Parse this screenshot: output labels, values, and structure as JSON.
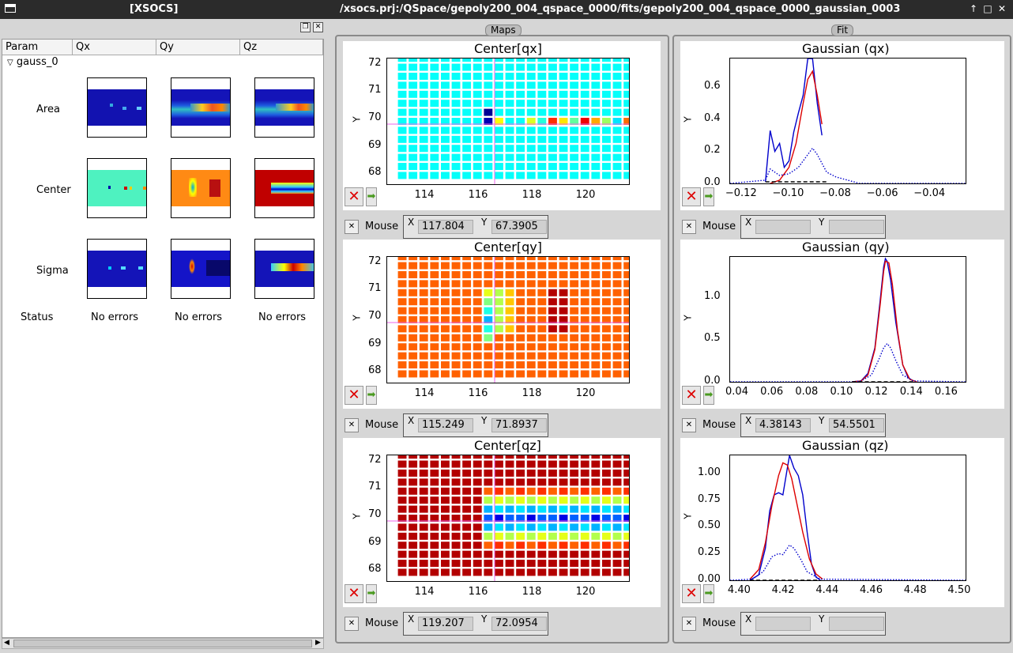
{
  "window": {
    "app_title": "[XSOCS]",
    "title": "/xsocs.prj:/QSpace/gepoly200_004_qspace_0000/fits/gepoly200_004_qspace_0000_gaussian_0003"
  },
  "left": {
    "columns": [
      "Param",
      "Qx",
      "Qy",
      "Qz"
    ],
    "tree_item": "gauss_0",
    "rows": [
      "Area",
      "Center",
      "Sigma"
    ],
    "status_label": "Status",
    "status_values": [
      "No errors",
      "No errors",
      "No errors"
    ]
  },
  "maps": {
    "group_title": "Maps",
    "plots": [
      {
        "title": "Center[qx]",
        "mouse_label": "Mouse",
        "x_label": "X",
        "y_label": "Y",
        "mouse_x": "117.804",
        "mouse_y": "67.3905"
      },
      {
        "title": "Center[qy]",
        "mouse_label": "Mouse",
        "x_label": "X",
        "y_label": "Y",
        "mouse_x": "115.249",
        "mouse_y": "71.8937"
      },
      {
        "title": "Center[qz]",
        "mouse_label": "Mouse",
        "x_label": "X",
        "y_label": "Y",
        "mouse_x": "119.207",
        "mouse_y": "72.0954"
      }
    ],
    "x_ticks": [
      "114",
      "116",
      "118",
      "120"
    ],
    "y_ticks": [
      "72",
      "71",
      "70",
      "69",
      "68"
    ]
  },
  "fit": {
    "group_title": "Fit",
    "plots": [
      {
        "title": "Gaussian (qx)",
        "mouse_label": "Mouse",
        "x_label": "X",
        "y_label": "Y",
        "mouse_x": "",
        "mouse_y": "",
        "x_ticks": [
          "−0.12",
          "−0.10",
          "−0.08",
          "−0.06",
          "−0.04"
        ],
        "y_ticks": [
          "0.6",
          "0.4",
          "0.2",
          "0.0"
        ]
      },
      {
        "title": "Gaussian (qy)",
        "mouse_label": "Mouse",
        "x_label": "X",
        "y_label": "Y",
        "mouse_x": "4.38143",
        "mouse_y": "54.5501",
        "x_ticks": [
          "0.04",
          "0.06",
          "0.08",
          "0.10",
          "0.12",
          "0.14",
          "0.16"
        ],
        "y_ticks": [
          "1.0",
          "0.5",
          "0.0"
        ]
      },
      {
        "title": "Gaussian (qz)",
        "mouse_label": "Mouse",
        "x_label": "X",
        "y_label": "Y",
        "mouse_x": "",
        "mouse_y": "",
        "x_ticks": [
          "4.40",
          "4.42",
          "4.44",
          "4.46",
          "4.48",
          "4.50"
        ],
        "y_ticks": [
          "1.00",
          "0.75",
          "0.50",
          "0.25",
          "0.00"
        ]
      }
    ]
  },
  "chart_data": [
    {
      "type": "heatmap",
      "title": "Center[qx]",
      "ylabel": "Y",
      "xlim": [
        112.6,
        121.6
      ],
      "ylim": [
        67.6,
        72.2
      ],
      "colormap": "jet",
      "crosshair": [
        116.6,
        69.8
      ]
    },
    {
      "type": "heatmap",
      "title": "Center[qy]",
      "ylabel": "Y",
      "xlim": [
        112.6,
        121.6
      ],
      "ylim": [
        67.6,
        72.2
      ],
      "colormap": "jet",
      "crosshair": [
        116.6,
        69.8
      ]
    },
    {
      "type": "heatmap",
      "title": "Center[qz]",
      "ylabel": "Y",
      "xlim": [
        112.6,
        121.6
      ],
      "ylim": [
        67.6,
        72.2
      ],
      "colormap": "jet",
      "crosshair": [
        116.6,
        69.8
      ]
    },
    {
      "type": "line",
      "title": "Gaussian (qx)",
      "ylabel": "Y",
      "xlim": [
        -0.125,
        -0.025
      ],
      "ylim": [
        0,
        0.78
      ],
      "series": [
        {
          "color": "#0000cc",
          "style": "solid",
          "x": [
            -0.11,
            -0.108,
            -0.106,
            -0.104,
            -0.102,
            -0.1,
            -0.098,
            -0.096,
            -0.094,
            -0.092,
            -0.09,
            -0.088,
            -0.086
          ],
          "y": [
            0.01,
            0.33,
            0.2,
            0.25,
            0.1,
            0.14,
            0.32,
            0.44,
            0.55,
            0.78,
            0.78,
            0.5,
            0.3
          ]
        },
        {
          "color": "#dd0000",
          "style": "solid",
          "x": [
            -0.108,
            -0.104,
            -0.1,
            -0.097,
            -0.094,
            -0.092,
            -0.09,
            -0.088,
            -0.086
          ],
          "y": [
            0.0,
            0.02,
            0.1,
            0.25,
            0.5,
            0.65,
            0.7,
            0.55,
            0.37
          ]
        },
        {
          "color": "#0000cc",
          "style": "dotted",
          "x": [
            -0.125,
            -0.11,
            -0.108,
            -0.104,
            -0.1,
            -0.096,
            -0.092,
            -0.09,
            -0.088,
            -0.084,
            -0.08,
            -0.07,
            -0.05,
            -0.025
          ],
          "y": [
            0.0,
            0.02,
            0.09,
            0.05,
            0.06,
            0.1,
            0.18,
            0.22,
            0.18,
            0.07,
            0.04,
            0.0,
            0.0,
            0.0
          ]
        },
        {
          "color": "#000000",
          "style": "dashed",
          "x": [
            -0.11,
            -0.084
          ],
          "y": [
            0.01,
            0.01
          ]
        }
      ]
    },
    {
      "type": "line",
      "title": "Gaussian (qy)",
      "ylabel": "Y",
      "xlim": [
        0.035,
        0.17
      ],
      "ylim": [
        0,
        1.47
      ],
      "series": [
        {
          "color": "#0000cc",
          "style": "solid",
          "x": [
            0.105,
            0.11,
            0.114,
            0.118,
            0.121,
            0.123,
            0.124,
            0.125,
            0.127,
            0.13,
            0.134,
            0.137,
            0.14
          ],
          "y": [
            0.0,
            0.01,
            0.1,
            0.4,
            0.95,
            1.35,
            1.45,
            1.42,
            1.2,
            0.7,
            0.2,
            0.05,
            0.01
          ]
        },
        {
          "color": "#dd0000",
          "style": "solid",
          "x": [
            0.105,
            0.11,
            0.114,
            0.118,
            0.121,
            0.123,
            0.124,
            0.126,
            0.128,
            0.131,
            0.134,
            0.138,
            0.142
          ],
          "y": [
            0.0,
            0.01,
            0.08,
            0.38,
            0.9,
            1.3,
            1.42,
            1.4,
            1.15,
            0.6,
            0.2,
            0.03,
            0.0
          ]
        },
        {
          "color": "#0000cc",
          "style": "dotted",
          "x": [
            0.035,
            0.105,
            0.11,
            0.116,
            0.12,
            0.123,
            0.125,
            0.127,
            0.13,
            0.134,
            0.14,
            0.17
          ],
          "y": [
            0.0,
            0.0,
            0.01,
            0.08,
            0.25,
            0.4,
            0.45,
            0.4,
            0.25,
            0.08,
            0.01,
            0.0
          ]
        },
        {
          "color": "#000000",
          "style": "dashed",
          "x": [
            0.105,
            0.14
          ],
          "y": [
            0.0,
            0.0
          ]
        }
      ]
    },
    {
      "type": "line",
      "title": "Gaussian (qz)",
      "ylabel": "Y",
      "xlim": [
        4.395,
        4.502
      ],
      "ylim": [
        0,
        1.17
      ],
      "series": [
        {
          "color": "#0000cc",
          "style": "solid",
          "x": [
            4.404,
            4.408,
            4.411,
            4.413,
            4.415,
            4.417,
            4.419,
            4.421,
            4.422,
            4.424,
            4.426,
            4.428,
            4.43,
            4.432,
            4.434,
            4.436
          ],
          "y": [
            0.0,
            0.05,
            0.3,
            0.65,
            0.8,
            0.82,
            0.8,
            1.05,
            1.17,
            1.05,
            0.98,
            0.8,
            0.45,
            0.15,
            0.03,
            0.0
          ]
        },
        {
          "color": "#dd0000",
          "style": "solid",
          "x": [
            4.404,
            4.408,
            4.411,
            4.414,
            4.417,
            4.419,
            4.421,
            4.423,
            4.425,
            4.428,
            4.431,
            4.434,
            4.437
          ],
          "y": [
            0.01,
            0.1,
            0.35,
            0.7,
            0.98,
            1.1,
            1.08,
            0.95,
            0.75,
            0.45,
            0.2,
            0.06,
            0.01
          ]
        },
        {
          "color": "#0000cc",
          "style": "dotted",
          "x": [
            4.395,
            4.405,
            4.41,
            4.414,
            4.417,
            4.419,
            4.421,
            4.422,
            4.424,
            4.427,
            4.43,
            4.436,
            4.502
          ],
          "y": [
            0.0,
            0.01,
            0.08,
            0.22,
            0.25,
            0.24,
            0.3,
            0.33,
            0.3,
            0.2,
            0.08,
            0.01,
            0.0
          ]
        },
        {
          "color": "#000000",
          "style": "dashed",
          "x": [
            4.404,
            4.436
          ],
          "y": [
            0.0,
            0.0
          ]
        }
      ]
    }
  ]
}
